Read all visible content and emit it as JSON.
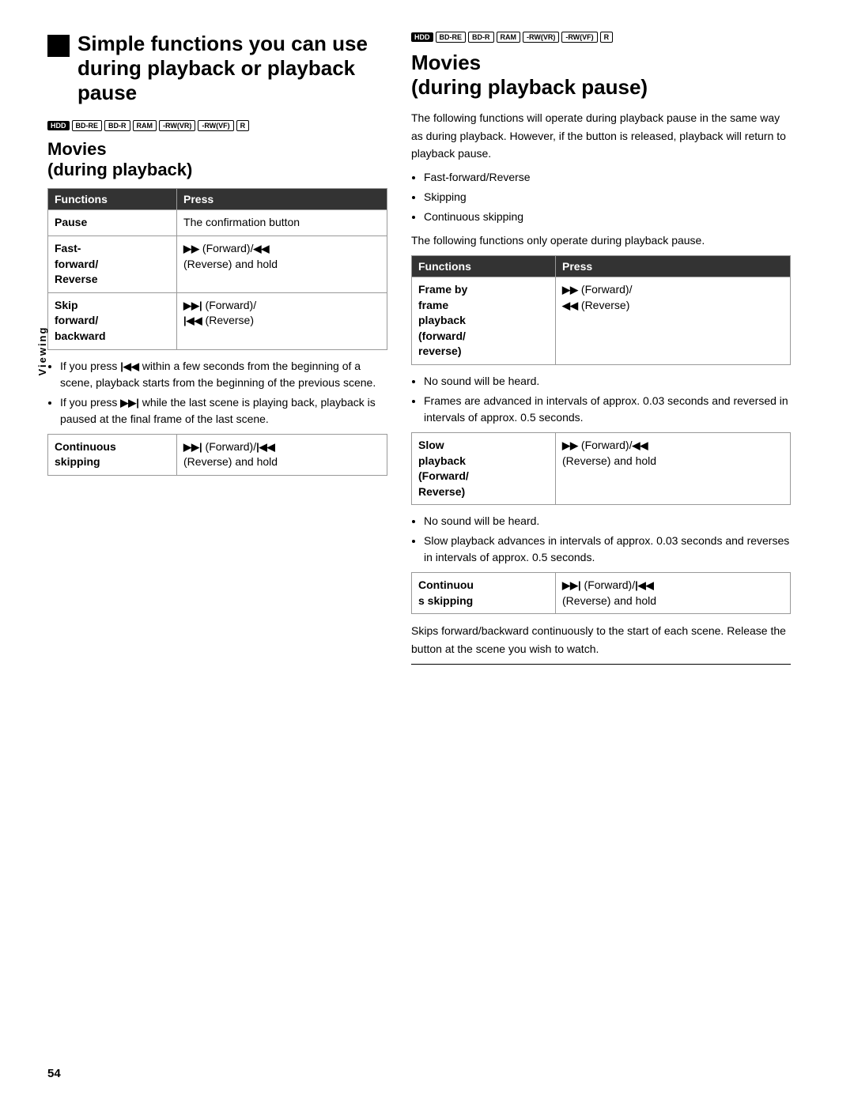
{
  "page": {
    "number": "54",
    "viewing_label": "Viewing"
  },
  "left_section": {
    "title": "Simple functions you can use during playback or playback pause",
    "badges": [
      "HDD",
      "BD-RE",
      "BD-R",
      "RAM",
      "-RW(VR)",
      "-RW(VF)",
      "R"
    ],
    "subsection_title": "Movies\n(during playback)",
    "table": {
      "col1": "Functions",
      "col2": "Press",
      "rows": [
        {
          "func": "Pause",
          "press": "The confirmation button"
        },
        {
          "func": "Fast-forward/ Reverse",
          "press": "▶▶ (Forward)/◀◀ (Reverse) and hold"
        },
        {
          "func": "Skip forward/ backward",
          "press": "▶▶| (Forward)/ |◀◀ (Reverse)"
        }
      ]
    },
    "notes": [
      "If you press |◀◀ within a few seconds from the beginning of a scene, playback starts from the beginning of the previous scene.",
      "If you press ▶▶| while the last scene is playing back, playback is paused at the final frame of the last scene."
    ],
    "table2": {
      "rows": [
        {
          "func": "Continuous skipping",
          "press": "▶▶| (Forward)/|◀◀ (Reverse) and hold"
        }
      ]
    }
  },
  "right_section": {
    "badges": [
      "HDD",
      "BD-RE",
      "BD-R",
      "RAM",
      "-RW(VR)",
      "-RW(VF)",
      "R"
    ],
    "title": "Movies\n(during playback pause)",
    "intro": "The following functions will operate during playback pause in the same way as during playback. However, if the button is released, playback will return to playback pause.",
    "bullet_items": [
      "Fast-forward/Reverse",
      "Skipping",
      "Continuous skipping"
    ],
    "note2": "The following functions only operate during playback pause.",
    "table": {
      "col1": "Functions",
      "col2": "Press",
      "rows": [
        {
          "func": "Frame by frame playback (forward/ reverse)",
          "press": "▶▶ (Forward)/ ◀◀ (Reverse)"
        }
      ]
    },
    "notes_after_table1": [
      "No sound will be heard.",
      "Frames are advanced in intervals of approx. 0.03 seconds and reversed in intervals of approx. 0.5 seconds."
    ],
    "table2": {
      "rows": [
        {
          "func": "Slow playback (Forward/ Reverse)",
          "press": "▶▶ (Forward)/◀◀ (Reverse) and hold"
        }
      ]
    },
    "notes_after_table2": [
      "No sound will be heard.",
      "Slow playback advances in intervals of approx. 0.03 seconds and reverses in intervals of approx. 0.5 seconds."
    ],
    "table3": {
      "rows": [
        {
          "func": "Continuous skipping",
          "press": "▶▶| (Forward)/|◀◀ (Reverse) and hold"
        }
      ]
    },
    "final_note": "Skips forward/backward continuously to the start of each scene. Release the button at the scene you wish to watch."
  }
}
